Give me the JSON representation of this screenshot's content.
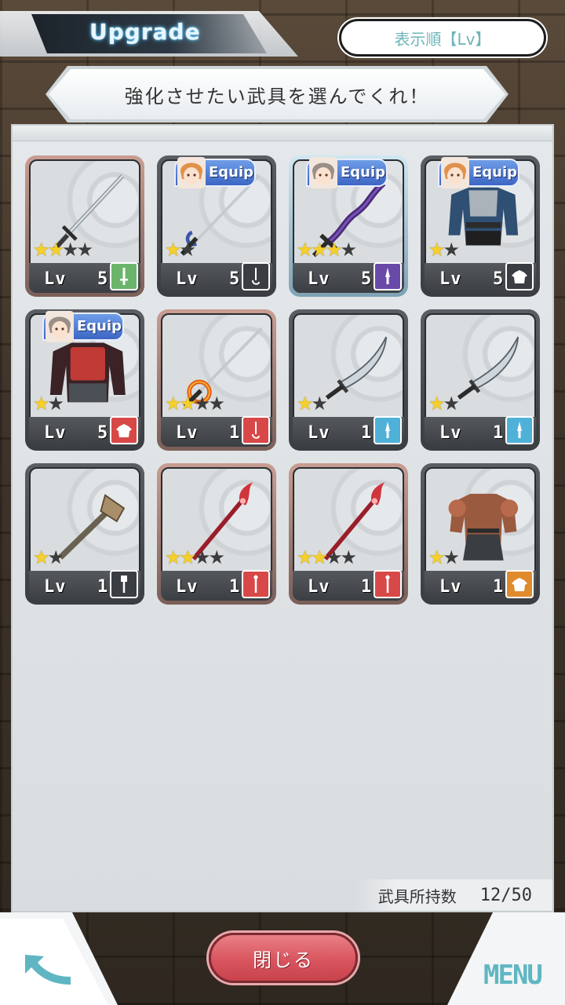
{
  "header": {
    "title": "Upgrade",
    "sort_label": "表示順【Lv】"
  },
  "banner": {
    "text": "強化させたい武具を選んでくれ！"
  },
  "grid": {
    "items": [
      {
        "kind": "sword",
        "stars": 2,
        "max_stars": 4,
        "lv_label": "Lv",
        "level": "5",
        "type_icon": "sword-icon",
        "type_color": "#6ab56a",
        "rarity_frame": "r2",
        "equip": null
      },
      {
        "kind": "rapier",
        "stars": 1,
        "max_stars": 2,
        "lv_label": "Lv",
        "level": "5",
        "type_icon": "rapier-icon",
        "type_color": "#3a3d41",
        "rarity_frame": "r1",
        "equip": "Equip"
      },
      {
        "kind": "dark-sword",
        "stars": 3,
        "max_stars": 4,
        "lv_label": "Lv",
        "level": "5",
        "type_icon": "dagger-icon",
        "type_color": "#6a4aa8",
        "rarity_frame": "r3",
        "equip": "Equip"
      },
      {
        "kind": "armor-blue",
        "stars": 1,
        "max_stars": 2,
        "lv_label": "Lv",
        "level": "5",
        "type_icon": "armor-icon",
        "type_color": "#3a3d41",
        "rarity_frame": "r1",
        "equip": "Equip"
      },
      {
        "kind": "armor-red",
        "stars": 1,
        "max_stars": 2,
        "lv_label": "Lv",
        "level": "5",
        "type_icon": "armor-icon",
        "type_color": "#d84848",
        "rarity_frame": "r1",
        "equip": "Equip"
      },
      {
        "kind": "fire-rapier",
        "stars": 2,
        "max_stars": 4,
        "lv_label": "Lv",
        "level": "1",
        "type_icon": "rapier-icon",
        "type_color": "#d84848",
        "rarity_frame": "r2",
        "equip": null
      },
      {
        "kind": "scimitar",
        "stars": 1,
        "max_stars": 2,
        "lv_label": "Lv",
        "level": "1",
        "type_icon": "dagger-icon",
        "type_color": "#4fb1d8",
        "rarity_frame": "r1",
        "equip": null
      },
      {
        "kind": "scimitar",
        "stars": 1,
        "max_stars": 2,
        "lv_label": "Lv",
        "level": "1",
        "type_icon": "dagger-icon",
        "type_color": "#4fb1d8",
        "rarity_frame": "r1",
        "equip": null
      },
      {
        "kind": "mace",
        "stars": 1,
        "max_stars": 2,
        "lv_label": "Lv",
        "level": "1",
        "type_icon": "mace-icon",
        "type_color": "#3a3d41",
        "rarity_frame": "r1",
        "equip": null
      },
      {
        "kind": "red-staff",
        "stars": 2,
        "max_stars": 4,
        "lv_label": "Lv",
        "level": "1",
        "type_icon": "spear-icon",
        "type_color": "#d84848",
        "rarity_frame": "r2",
        "equip": null
      },
      {
        "kind": "red-staff",
        "stars": 2,
        "max_stars": 4,
        "lv_label": "Lv",
        "level": "1",
        "type_icon": "spear-icon",
        "type_color": "#d84848",
        "rarity_frame": "r2",
        "equip": null
      },
      {
        "kind": "armor-brown",
        "stars": 1,
        "max_stars": 2,
        "lv_label": "Lv",
        "level": "1",
        "type_icon": "armor-icon",
        "type_color": "#e08a2e",
        "rarity_frame": "r1",
        "equip": null
      }
    ]
  },
  "footer": {
    "label": "武具所持数",
    "count": "12/50"
  },
  "bottom": {
    "close_label": "閉じる",
    "menu_label": "MENU",
    "back_icon": "back-arrow-icon"
  },
  "colors": {
    "accent_teal": "#5fb6c2",
    "close_red": "#d9555e",
    "star_gold": "#f5cf2a"
  }
}
